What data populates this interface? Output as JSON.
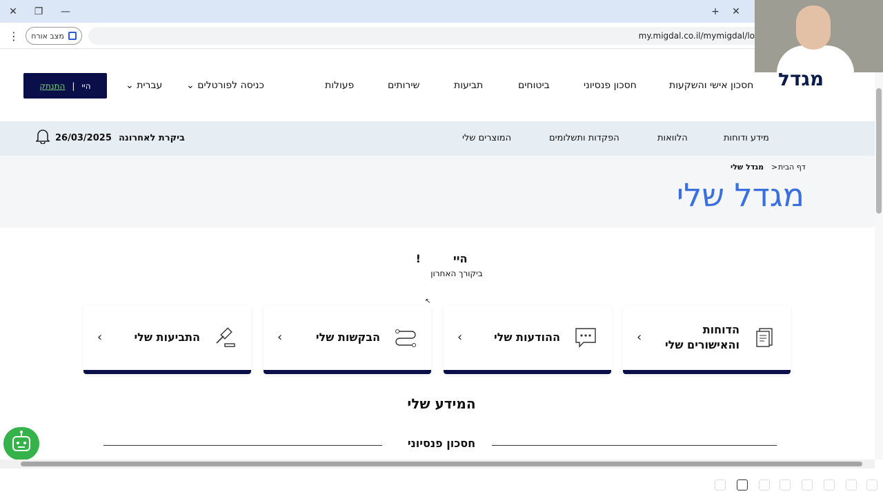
{
  "browser": {
    "url": "my.migdal.co.il/mymigdal/lo",
    "guest_label": "מצב אורח"
  },
  "header": {
    "logo": "מגדל",
    "nav": [
      "חסכון אישי והשקעות",
      "חסכון פנסיוני",
      "ביטוחים",
      "תביעות",
      "שירותים",
      "פעולות"
    ],
    "portals": "כניסה לפורטלים",
    "language": "עברית",
    "hi": "היי",
    "logout": "התנתק"
  },
  "subnav": {
    "items": [
      "מידע ודוחות",
      "הלוואות",
      "הפקדות ותשלומים",
      "המוצרים שלי"
    ],
    "last_visit_label": "ביקרת לאחרונה",
    "last_visit_date": "26/03/2025"
  },
  "hero": {
    "breadcrumb_home": "דף הבית",
    "breadcrumb_sep": ">",
    "breadcrumb_current": "מגדל שלי",
    "title": "מגדל שלי"
  },
  "greeting": {
    "hi": "היי",
    "excl": "!",
    "sub": "ביקורך האחרון"
  },
  "cards": [
    {
      "label": "הדוחות והאישורים שלי",
      "icon": "document-icon"
    },
    {
      "label": "ההודעות שלי",
      "icon": "chat-icon"
    },
    {
      "label": "הבקשות שלי",
      "icon": "route-icon"
    },
    {
      "label": "התביעות שלי",
      "icon": "gavel-icon"
    }
  ],
  "section": {
    "title": "המידע שלי",
    "pension": "חסכון פנסיוני"
  }
}
